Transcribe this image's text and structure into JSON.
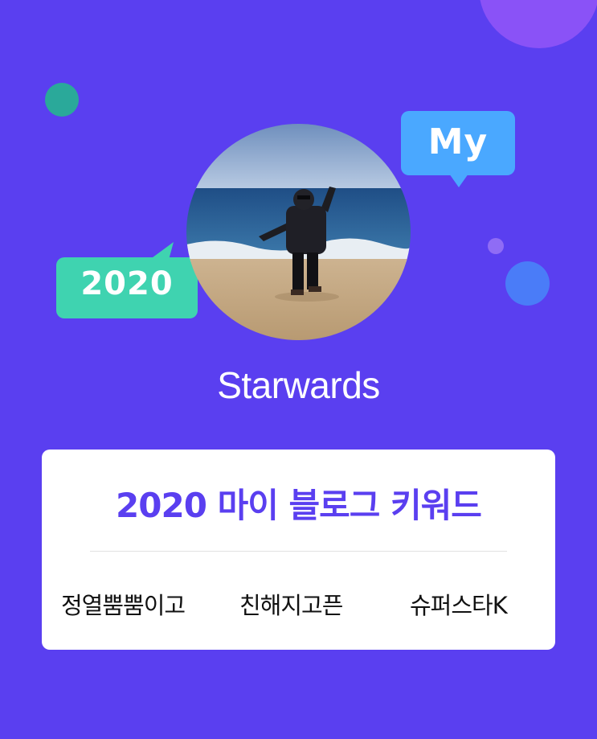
{
  "colors": {
    "background": "#5a3ff0",
    "accent_title": "#5a3ff0",
    "bubble_my": "#4aa8ff",
    "bubble_2020": "#3fd3b0"
  },
  "bubbles": {
    "my_label": "My",
    "year_label": "2020"
  },
  "profile": {
    "avatar_icon": "profile-photo-beach",
    "username": "Starwards"
  },
  "keyword_card": {
    "title": "2020 마이 블로그 키워드",
    "keywords": [
      "정열뿜뿜이고",
      "친해지고픈",
      "슈퍼스타K"
    ]
  }
}
